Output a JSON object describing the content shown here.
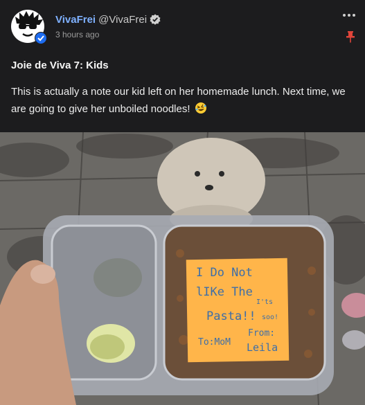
{
  "author": {
    "display_name": "VivaFrei",
    "handle": "@VivaFrei",
    "timestamp": "3 hours ago"
  },
  "icons": {
    "more": "more-horizontal-icon",
    "pin": "pin-icon",
    "verified": "verified-badge-icon",
    "emoji": "rolling-on-floor-laughing-emoji"
  },
  "colors": {
    "background": "#1c1c1e",
    "name": "#7fb1ff",
    "pin": "#e0453a",
    "sticky_note": "#ffb54a"
  },
  "post": {
    "title": "Joie de Viva 7: Kids",
    "body": "This is actually a note our kid left on her homemade lunch. Next time, we are going to give her unboiled noodles!"
  },
  "photo": {
    "note_lines": [
      "I Do Not",
      "lIKe The",
      "Pasta!!",
      "To:MoM",
      "From:",
      "Leila"
    ],
    "note_side": [
      "I'ts",
      "soo!"
    ]
  }
}
